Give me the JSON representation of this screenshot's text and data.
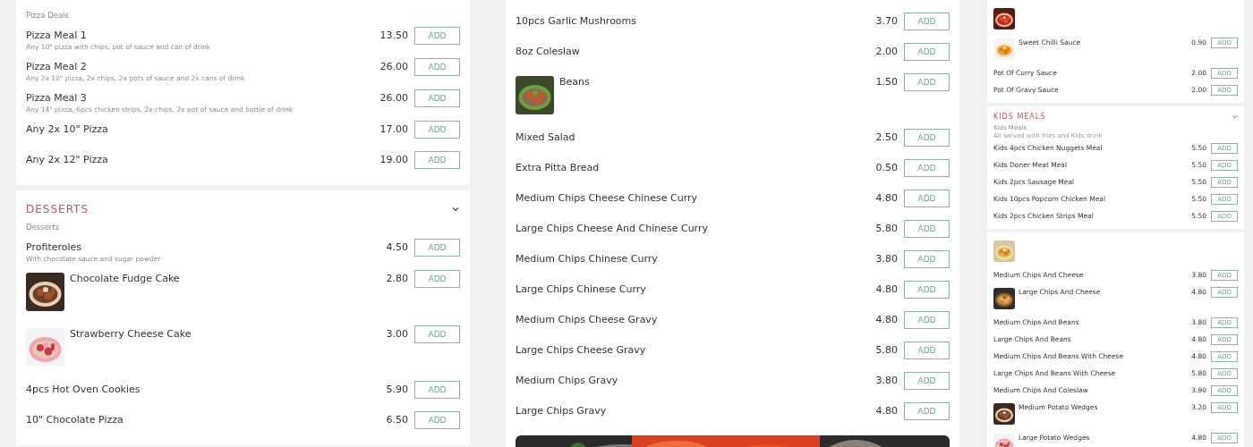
{
  "columns": [
    {
      "compact": false,
      "cards": [
        {
          "subtitle": "Pizza Deals",
          "items": [
            {
              "name": "Pizza Meal 1",
              "description": "Any 10\" pizza with chips, pot of sauce and can of drink",
              "price": "13.50",
              "button": "ADD",
              "image": false
            },
            {
              "name": "Pizza Meal 2",
              "description": "Any 2x 10\" pizza, 2x chips, 2x pots of sauce and 2x cans of drink",
              "price": "26.00",
              "button": "ADD",
              "image": false
            },
            {
              "name": "Pizza Meal 3",
              "description": "Any 14\" pizza, 6pcs chicken strips, 2x chips, 2x pot of sauce and bottle of drink",
              "price": "26.00",
              "button": "ADD",
              "image": false
            },
            {
              "name": "Any 2x 10\" Pizza",
              "price": "17.00",
              "button": "ADD",
              "image": false
            },
            {
              "name": "Any 2x 12\" Pizza",
              "price": "19.00",
              "button": "ADD",
              "image": false
            }
          ]
        },
        {
          "title": "DESSERTS",
          "expanded": true,
          "subtitle": "Desserts",
          "items": [
            {
              "name": "Profiteroles",
              "description": "With chocolate sauce and sugar powder",
              "price": "4.50",
              "button": "ADD",
              "image": false
            },
            {
              "name": "Chocolate Fudge Cake",
              "price": "2.80",
              "button": "ADD",
              "image": true
            },
            {
              "name": "Strawberry Cheese Cake",
              "price": "3.00",
              "button": "ADD",
              "image": true
            },
            {
              "name": "4pcs Hot Oven Cookies",
              "price": "5.90",
              "button": "ADD",
              "image": false
            },
            {
              "name": "10\" Chocolate Pizza",
              "price": "6.50",
              "button": "ADD",
              "image": false
            }
          ]
        }
      ]
    },
    {
      "compact": false,
      "cards": [
        {
          "items": [
            {
              "name": "10pcs Garlic Mushrooms",
              "price": "3.70",
              "button": "ADD",
              "image": false
            },
            {
              "name": "8oz Coleslaw",
              "price": "2.00",
              "button": "ADD",
              "image": false
            },
            {
              "name": "Beans",
              "price": "1.50",
              "button": "ADD",
              "image": true
            },
            {
              "name": "Mixed Salad",
              "price": "2.50",
              "button": "ADD",
              "image": false
            },
            {
              "name": "Extra Pitta Bread",
              "price": "0.50",
              "button": "ADD",
              "image": false
            },
            {
              "name": "Medium Chips Cheese Chinese Curry",
              "price": "4.80",
              "button": "ADD",
              "image": false
            },
            {
              "name": "Large Chips Cheese And Chinese Curry",
              "price": "5.80",
              "button": "ADD",
              "image": false
            },
            {
              "name": "Medium Chips Chinese Curry",
              "price": "3.80",
              "button": "ADD",
              "image": false
            },
            {
              "name": "Large Chips Chinese Curry",
              "price": "4.80",
              "button": "ADD",
              "image": false
            },
            {
              "name": "Medium Chips Cheese Gravy",
              "price": "4.80",
              "button": "ADD",
              "image": false
            },
            {
              "name": "Large Chips Cheese Gravy",
              "price": "5.80",
              "button": "ADD",
              "image": false
            },
            {
              "name": "Medium Chips Gravy",
              "price": "3.80",
              "button": "ADD",
              "image": false
            },
            {
              "name": "Large Chips Gravy",
              "price": "4.80",
              "button": "ADD",
              "image": false
            }
          ]
        }
      ]
    },
    {
      "compact": true,
      "cards": [
        {
          "items": [
            {
              "image": true
            },
            {
              "name": "Sweet Chilli Sauce",
              "price": "0.90",
              "button": "ADD",
              "image": true
            },
            {
              "name": "Pot Of Curry Sauce",
              "price": "2.00",
              "button": "ADD",
              "image": false
            },
            {
              "name": "Pot Of Gravy Sauce",
              "price": "2.00",
              "button": "ADD",
              "image": false
            }
          ]
        },
        {
          "title": "KIDS MEALS",
          "expanded": true,
          "subtitle": "Kids Meals",
          "note": "All served with fries and Kids drink",
          "items": [
            {
              "name": "Kids 4pcs Chicken Nuggets Meal",
              "price": "5.50",
              "button": "ADD",
              "image": false
            },
            {
              "name": "Kids Doner Meat Meal",
              "price": "5.50",
              "button": "ADD",
              "image": false
            },
            {
              "name": "Kids 2pcs Sausage Meal",
              "price": "5.50",
              "button": "ADD",
              "image": false
            },
            {
              "name": "Kids 10pcs Popcorn Chicken Meal",
              "price": "5.50",
              "button": "ADD",
              "image": false
            },
            {
              "name": "Kids 2pcs Chicken Strips Meal",
              "price": "5.50",
              "button": "ADD",
              "image": false
            }
          ]
        },
        {
          "items": [
            {
              "image": true
            },
            {
              "name": "Medium Chips And Cheese",
              "price": "3.80",
              "button": "ADD",
              "image": false
            },
            {
              "name": "Large Chips And Cheese",
              "price": "4.80",
              "button": "ADD",
              "image": true
            },
            {
              "name": "Medium Chips And Beans",
              "price": "3.80",
              "button": "ADD",
              "image": false
            },
            {
              "name": "Large Chips And Beans",
              "price": "4.80",
              "button": "ADD",
              "image": false
            },
            {
              "name": "Medium Chips And Beans With Cheese",
              "price": "4.80",
              "button": "ADD",
              "image": false
            },
            {
              "name": "Large Chips And Beans With Cheese",
              "price": "5.80",
              "button": "ADD",
              "image": false
            },
            {
              "name": "Medium Chips And Coleslaw",
              "price": "3.90",
              "button": "ADD",
              "image": false
            },
            {
              "name": "Medium Potato Wedges",
              "price": "3.20",
              "button": "ADD",
              "image": true
            },
            {
              "name": "Large Potato Wedges",
              "price": "4.80",
              "button": "ADD",
              "image": true
            }
          ]
        }
      ]
    }
  ]
}
